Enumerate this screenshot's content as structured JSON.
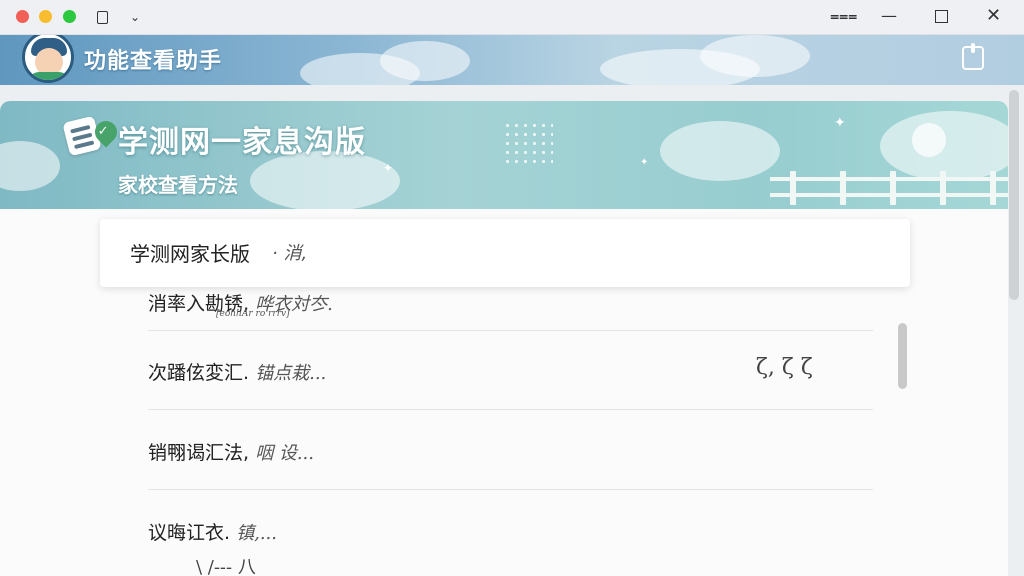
{
  "window": {
    "controls": [
      "close",
      "minimize",
      "maximize"
    ],
    "right_icons": [
      "menu-icon",
      "minimize-icon",
      "maximize-icon",
      "close-icon"
    ]
  },
  "header": {
    "title": "功能查看助手",
    "exit_icon": "exit-icon"
  },
  "banner": {
    "title": "学测网一家息沟版",
    "subtitle": "家校查看方法"
  },
  "notice": {
    "title": "学测网家长版",
    "extra": "· 消,"
  },
  "list": {
    "items": [
      {
        "text": "消率入勘锈,",
        "note": "哗衣対冭.",
        "sub": "[eohhAr ro rrrv]",
        "right": ""
      },
      {
        "text": "次蹯伭変汇.",
        "note": "锚点栽...",
        "sub": "",
        "right": "ζ,   ζ ζ"
      },
      {
        "text": "销翈谒汇法,",
        "note": "咽 设...",
        "sub": "",
        "right": ""
      },
      {
        "text": "议晦讧衣.",
        "note": "镇,...",
        "sub": "",
        "right": ""
      }
    ],
    "bottom_scribble": "\\      /--- 八"
  },
  "colors": {
    "header_gradient_start": "#5f97bf",
    "banner_teal": "#a5d3d5",
    "check_green": "#47a36a",
    "traffic_red": "#f25f57",
    "traffic_yellow": "#f8bd2e",
    "traffic_green": "#2bc840"
  }
}
